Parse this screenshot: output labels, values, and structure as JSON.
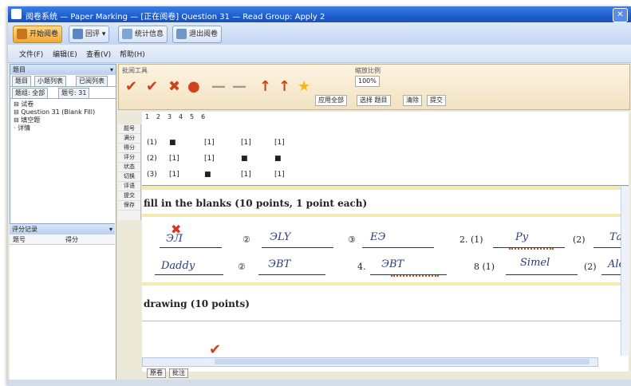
{
  "window": {
    "title": "阅卷系统 — Paper Marking — [正在阅卷] Question 31 — Read Group: Apply 2"
  },
  "toolbar": [
    {
      "label": "开始阅卷",
      "active": true
    },
    {
      "label": "回评 ▾",
      "active": false
    },
    {
      "label": "统计信息",
      "active": false
    },
    {
      "label": "退出阅卷",
      "active": false
    }
  ],
  "menu": [
    "文件(F)",
    "编辑(E)",
    "查看(V)",
    "帮助(H)"
  ],
  "left_pane": {
    "header": "题目",
    "tabs": [
      "题目",
      "小题列表",
      "已阅列表"
    ],
    "filters": [
      "题组: 全部",
      "题号: 31"
    ],
    "tree": [
      "⊟ 试卷",
      "  ⊟ Question 31 (Blank Fill)",
      "    ⊟ 填空题",
      "      · 详情"
    ],
    "lower_header": "评分记录",
    "lower_columns": [
      "题号",
      "得分"
    ]
  },
  "mark_tools": {
    "label": "批阅工具",
    "icons": [
      "✔",
      "✔",
      "✖",
      "●",
      "—",
      "—",
      "↑",
      "↑",
      "★"
    ],
    "icon_colors": [
      "#d0421a",
      "#d0421a",
      "#d0421a",
      "#d0421a",
      "#999999",
      "#999999",
      "#d0421a",
      "#d0421a",
      "#f2b81b"
    ],
    "zoom_label": "缩放比例",
    "zoom_value": "100%",
    "buttons": [
      "应用全部",
      "选择 题目",
      "清除",
      "提交"
    ]
  },
  "side_strip": [
    "题号",
    "满分",
    "得分",
    "评分",
    "状态",
    "切换",
    "评语",
    "提交",
    "保存"
  ],
  "score_table": {
    "header_row": [
      "1",
      "2",
      "3",
      "4",
      "5",
      "6"
    ],
    "rows": [
      {
        "label": "(1)",
        "cells": [
          "■",
          "[1]",
          "[1]",
          "[1]"
        ]
      },
      {
        "label": "(2)",
        "cells": [
          "[1]",
          "[1]",
          "■",
          "■"
        ]
      },
      {
        "label": "(3)",
        "cells": [
          "[1]",
          "■",
          "[1]",
          "[1]"
        ]
      }
    ]
  },
  "sheet": {
    "section1": "fill in the blanks  (10 points, 1 point each)",
    "row1": [
      {
        "num": "",
        "hand": "ЭЛ"
      },
      {
        "num": "②",
        "hand": "ЭLY"
      },
      {
        "num": "③",
        "hand": "ЕЭ"
      },
      {
        "num": "2. (1)",
        "hand": "Ру"
      },
      {
        "num": "(2)",
        "hand": "Та"
      }
    ],
    "row2": [
      {
        "num": "",
        "hand": "Daddy"
      },
      {
        "num": "②",
        "hand": "ЭВТ"
      },
      {
        "num": "4.",
        "hand": "ЭВТ"
      },
      {
        "num": "8 (1)",
        "hand": "Simel"
      },
      {
        "num": "(2)",
        "hand": "Ale"
      }
    ],
    "section2": "drawing  (10 points)",
    "check": "✔"
  },
  "bottom_tabs": [
    "原卷",
    "批注"
  ]
}
